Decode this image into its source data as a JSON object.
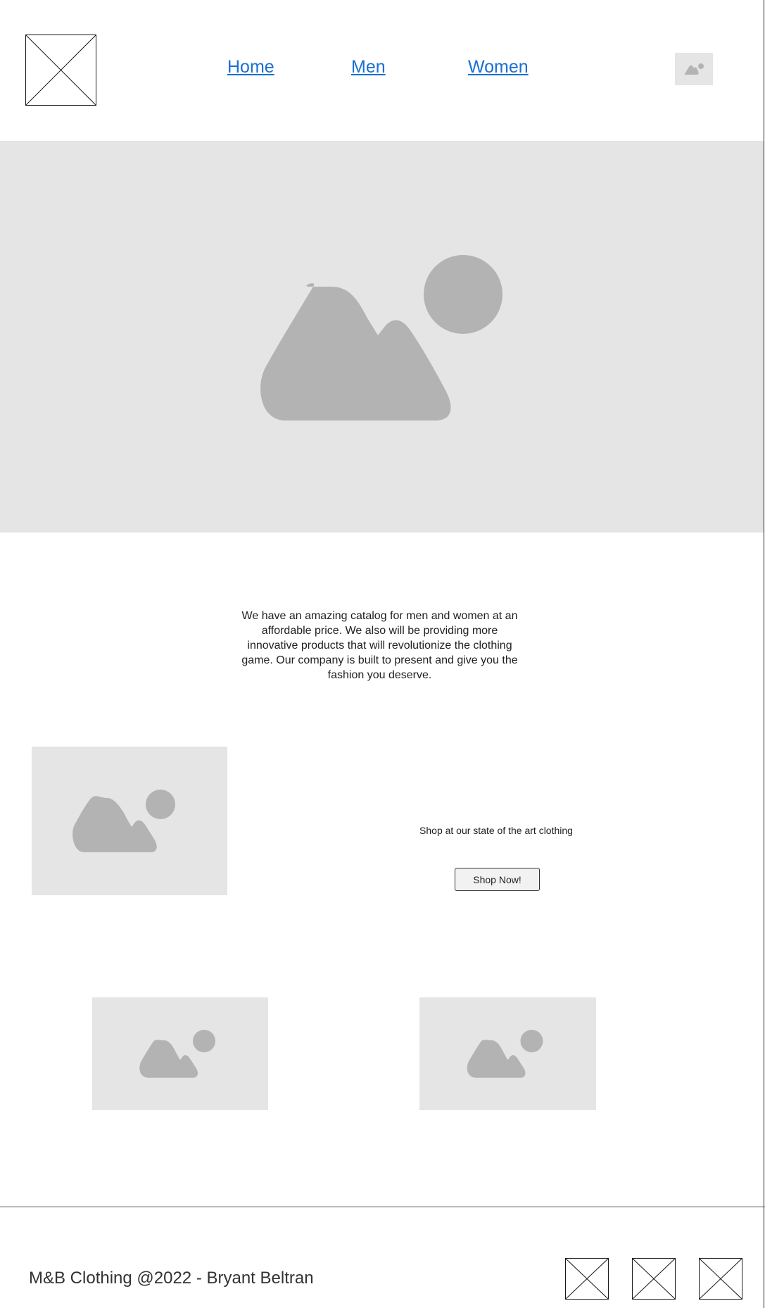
{
  "header": {
    "logo_icon": "placeholder-x-icon",
    "nav": [
      {
        "label": "Home"
      },
      {
        "label": "Men"
      },
      {
        "label": "Women"
      }
    ],
    "profile_icon": "image-placeholder-icon"
  },
  "hero": {
    "icon": "image-placeholder-icon",
    "background_color": "#e5e5e5",
    "icon_color": "#b3b3b3"
  },
  "intro": {
    "text": "We have an amazing catalog for men and women at an affordable price. We also will be providing more innovative products that will revolutionize the clothing game. Our company is built to present and give you the fashion you deserve."
  },
  "promo": {
    "text": "Shop at our state of the art clothing",
    "button_label": "Shop Now!"
  },
  "gallery": {
    "items": [
      {
        "icon": "image-placeholder-icon"
      },
      {
        "icon": "image-placeholder-icon"
      }
    ]
  },
  "footer": {
    "text": "M&B Clothing @2022 - Bryant Beltran",
    "social_icons": [
      "placeholder-x-icon",
      "placeholder-x-icon",
      "placeholder-x-icon"
    ]
  },
  "colors": {
    "link": "#1a6fd1",
    "placeholder_bg": "#e5e5e5",
    "placeholder_fg": "#b3b3b3"
  }
}
